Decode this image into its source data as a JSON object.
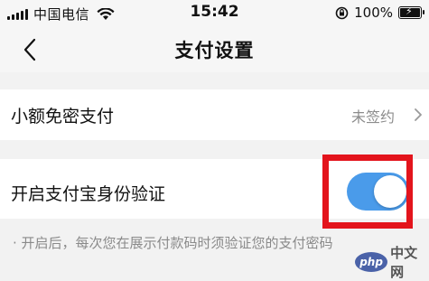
{
  "status_bar": {
    "carrier": "中国电信",
    "time": "15:42",
    "battery_percent": "100%",
    "icons": [
      "signal-icon",
      "wifi-icon",
      "orientation-lock-icon",
      "battery-charging-icon"
    ]
  },
  "nav": {
    "title": "支付设置",
    "back_icon": "chevron-left-icon"
  },
  "settings": {
    "small_amount": {
      "label": "小额免密支付",
      "value": "未签约",
      "icon": "chevron-right-icon"
    },
    "alipay_verify": {
      "label": "开启支付宝身份验证",
      "toggle_on": true,
      "toggle_color": "#4a9bea"
    }
  },
  "note": "· 开启后，每次您在展示付款码时须验证您的支付密码",
  "highlight_color": "#e3141c",
  "watermark": {
    "logo": "php",
    "text": "中文网"
  }
}
